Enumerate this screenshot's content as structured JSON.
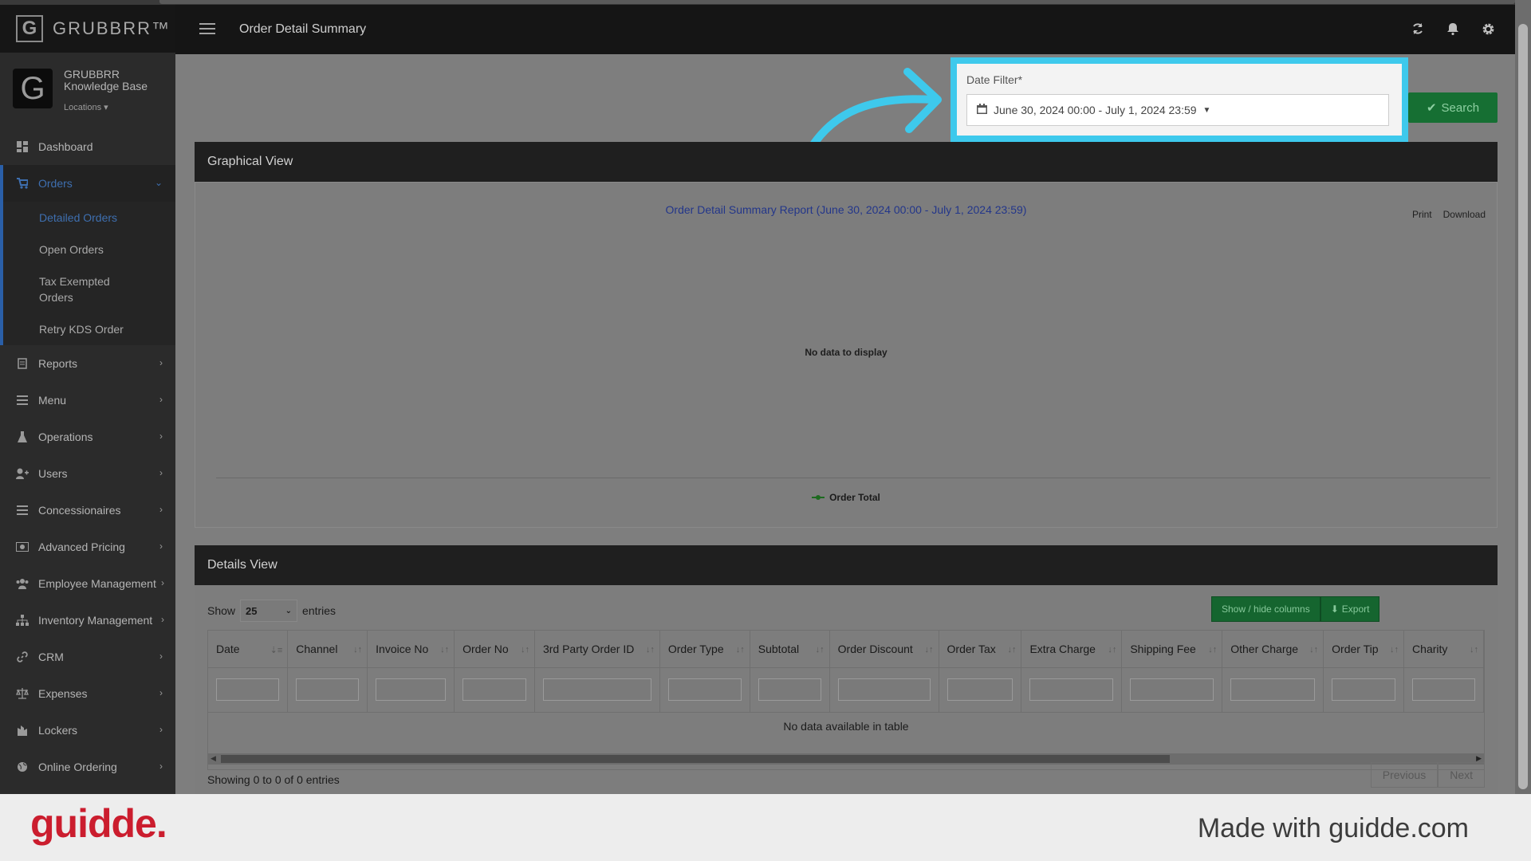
{
  "app": {
    "brand": "GRUBBRR™",
    "brand_letter": "G",
    "org_name": "GRUBBRR Knowledge Base",
    "locations_label": "Locations"
  },
  "header": {
    "title": "Order Detail Summary"
  },
  "sidebar": {
    "items": [
      {
        "label": "Dashboard",
        "icon": "dashboard-icon"
      },
      {
        "label": "Orders",
        "icon": "cart-icon"
      },
      {
        "label": "Reports",
        "icon": "report-icon"
      },
      {
        "label": "Menu",
        "icon": "list-icon"
      },
      {
        "label": "Operations",
        "icon": "flask-icon"
      },
      {
        "label": "Users",
        "icon": "user-plus-icon"
      },
      {
        "label": "Concessionaires",
        "icon": "list-icon"
      },
      {
        "label": "Advanced Pricing",
        "icon": "money-icon"
      },
      {
        "label": "Employee Management",
        "icon": "users-icon"
      },
      {
        "label": "Inventory Management",
        "icon": "sitemap-icon"
      },
      {
        "label": "CRM",
        "icon": "link-icon"
      },
      {
        "label": "Expenses",
        "icon": "scale-icon"
      },
      {
        "label": "Lockers",
        "icon": "lockers-icon"
      },
      {
        "label": "Online Ordering",
        "icon": "globe-icon"
      }
    ],
    "orders_sub": [
      "Detailed Orders",
      "Open Orders",
      "Tax Exempted Orders",
      "Retry KDS Order"
    ]
  },
  "filter": {
    "label": "Date Filter*",
    "value": "June 30, 2024 00:00 - July 1, 2024 23:59",
    "search_label": "Search"
  },
  "graph": {
    "panel_title": "Graphical View",
    "report_title": "Order Detail Summary Report (June 30, 2024 00:00 - July 1, 2024 23:59)",
    "print": "Print",
    "download": "Download",
    "no_data": "No data to display",
    "legend": "Order Total"
  },
  "details": {
    "panel_title": "Details View",
    "show": "Show",
    "entries_value": "25",
    "entries": "entries",
    "show_hide": "Show / hide columns",
    "export": "Export",
    "columns": [
      "Date",
      "Channel",
      "Invoice No",
      "Order No",
      "3rd Party Order ID",
      "Order Type",
      "Subtotal",
      "Order Discount",
      "Order Tax",
      "Extra Charge",
      "Shipping Fee",
      "Other Charge",
      "Order Tip",
      "Charity"
    ],
    "empty": "No data available in table",
    "showing": "Showing 0 to 0 of 0 entries",
    "previous": "Previous",
    "next": "Next"
  },
  "footer": {
    "logo": "guidde.",
    "made_with": "Made with guidde.com"
  },
  "colors": {
    "highlight": "#3ec9ec",
    "search_green": "#166f33",
    "guidde_red": "#cb1d2e"
  }
}
